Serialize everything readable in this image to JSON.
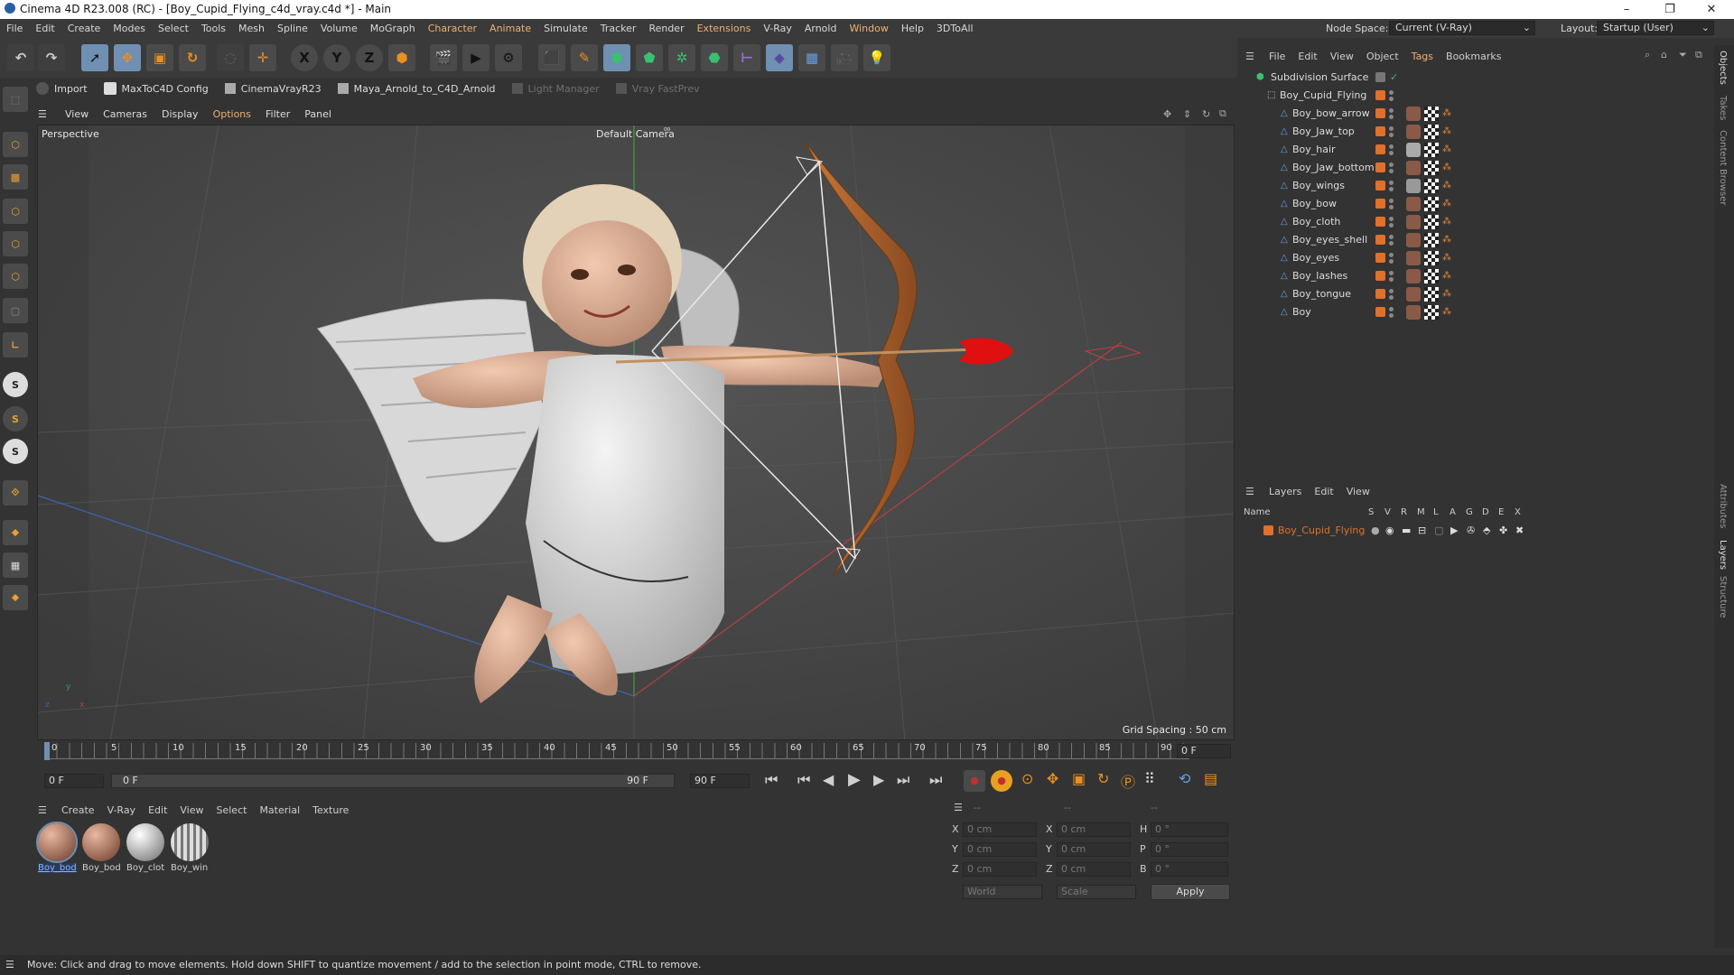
{
  "window": {
    "title": "Cinema 4D R23.008 (RC) - [Boy_Cupid_Flying_c4d_vray.c4d *] - Main",
    "controls": [
      "–",
      "❐",
      "✕"
    ]
  },
  "menubar": {
    "items": [
      "File",
      "Edit",
      "Create",
      "Modes",
      "Select",
      "Tools",
      "Mesh",
      "Spline",
      "Volume",
      "MoGraph",
      "Character",
      "Animate",
      "Simulate",
      "Tracker",
      "Render",
      "Extensions",
      "V-Ray",
      "Arnold",
      "Window",
      "Help",
      "3DToAll"
    ],
    "highlighted": [
      "Character",
      "Animate",
      "Extensions"
    ],
    "node_space_label": "Node Space:",
    "node_space_value": "Current (V-Ray)",
    "layout_label": "Layout:",
    "layout_value": "Startup (User)"
  },
  "toolbar": {
    "axis_x": "X",
    "axis_y": "Y",
    "axis_z": "Z"
  },
  "plugbar": {
    "items": [
      "Import",
      "MaxToC4D Config",
      "CinemaVrayR23",
      "Maya_Arnold_to_C4D_Arnold",
      "Light Manager",
      "Vray FastPrev"
    ]
  },
  "viewport_menu": {
    "items": [
      "View",
      "Cameras",
      "Display",
      "Options",
      "Filter",
      "Panel"
    ]
  },
  "viewport": {
    "view_name": "Perspective",
    "camera": "Default Camera",
    "camera_mark": "⁰⁰",
    "grid_spacing": "Grid Spacing : 50 cm",
    "axis_y": "y",
    "axis_z": "z",
    "axis_x": "x"
  },
  "timeline": {
    "ticks": [
      "0",
      "5",
      "10",
      "15",
      "20",
      "25",
      "30",
      "35",
      "40",
      "45",
      "50",
      "55",
      "60",
      "65",
      "70",
      "75",
      "80",
      "85",
      "90"
    ],
    "current_frame": "0 F"
  },
  "transport": {
    "start_field": "0 F",
    "range_start": "0 F",
    "range_end": "90 F",
    "end_field": "90 F"
  },
  "material_manager": {
    "menu": [
      "Create",
      "V-Ray",
      "Edit",
      "View",
      "Select",
      "Material",
      "Texture"
    ],
    "materials": [
      "Boy_bod",
      "Boy_bod",
      "Boy_clot",
      "Boy_win"
    ]
  },
  "coordinates": {
    "header_a": "--",
    "header_b": "--",
    "header_c": "--",
    "rows": [
      {
        "a": "X",
        "av": "0 cm",
        "b": "X",
        "bv": "0 cm",
        "c": "H",
        "cv": "0 °"
      },
      {
        "a": "Y",
        "av": "0 cm",
        "b": "Y",
        "bv": "0 cm",
        "c": "P",
        "cv": "0 °"
      },
      {
        "a": "Z",
        "av": "0 cm",
        "b": "Z",
        "bv": "0 cm",
        "c": "B",
        "cv": "0 °"
      }
    ],
    "space": "World",
    "mode": "Scale",
    "apply": "Apply"
  },
  "object_manager": {
    "menu": [
      "File",
      "Edit",
      "View",
      "Object",
      "Tags",
      "Bookmarks"
    ],
    "root": "Subdivision Surface",
    "group": "Boy_Cupid_Flying",
    "objects": [
      "Boy_bow_arrow",
      "Boy_Jaw_top",
      "Boy_hair",
      "Boy_Jaw_bottom",
      "Boy_wings",
      "Boy_bow",
      "Boy_cloth",
      "Boy_eyes_shell",
      "Boy_eyes",
      "Boy_lashes",
      "Boy_tongue",
      "Boy"
    ]
  },
  "layer_manager": {
    "menu": [
      "Layers",
      "Edit",
      "View"
    ],
    "col_name": "Name",
    "columns": [
      "S",
      "V",
      "R",
      "M",
      "L",
      "A",
      "G",
      "D",
      "E",
      "X"
    ],
    "layers": [
      "Boy_Cupid_Flying"
    ],
    "layer_color": "#e0702a"
  },
  "right_side_tabs": [
    "Objects",
    "Takes",
    "Content Browser",
    "Attributes",
    "Layers",
    "Structure"
  ],
  "status": "Move: Click and drag to move elements. Hold down SHIFT to quantize movement / add to the selection in point mode, CTRL to remove.",
  "colors": {
    "accent_orange": "#e0702a",
    "selection_blue": "#6f8fb3",
    "panel_bg": "#333333",
    "viewport_bg": "#4b4b4b"
  }
}
